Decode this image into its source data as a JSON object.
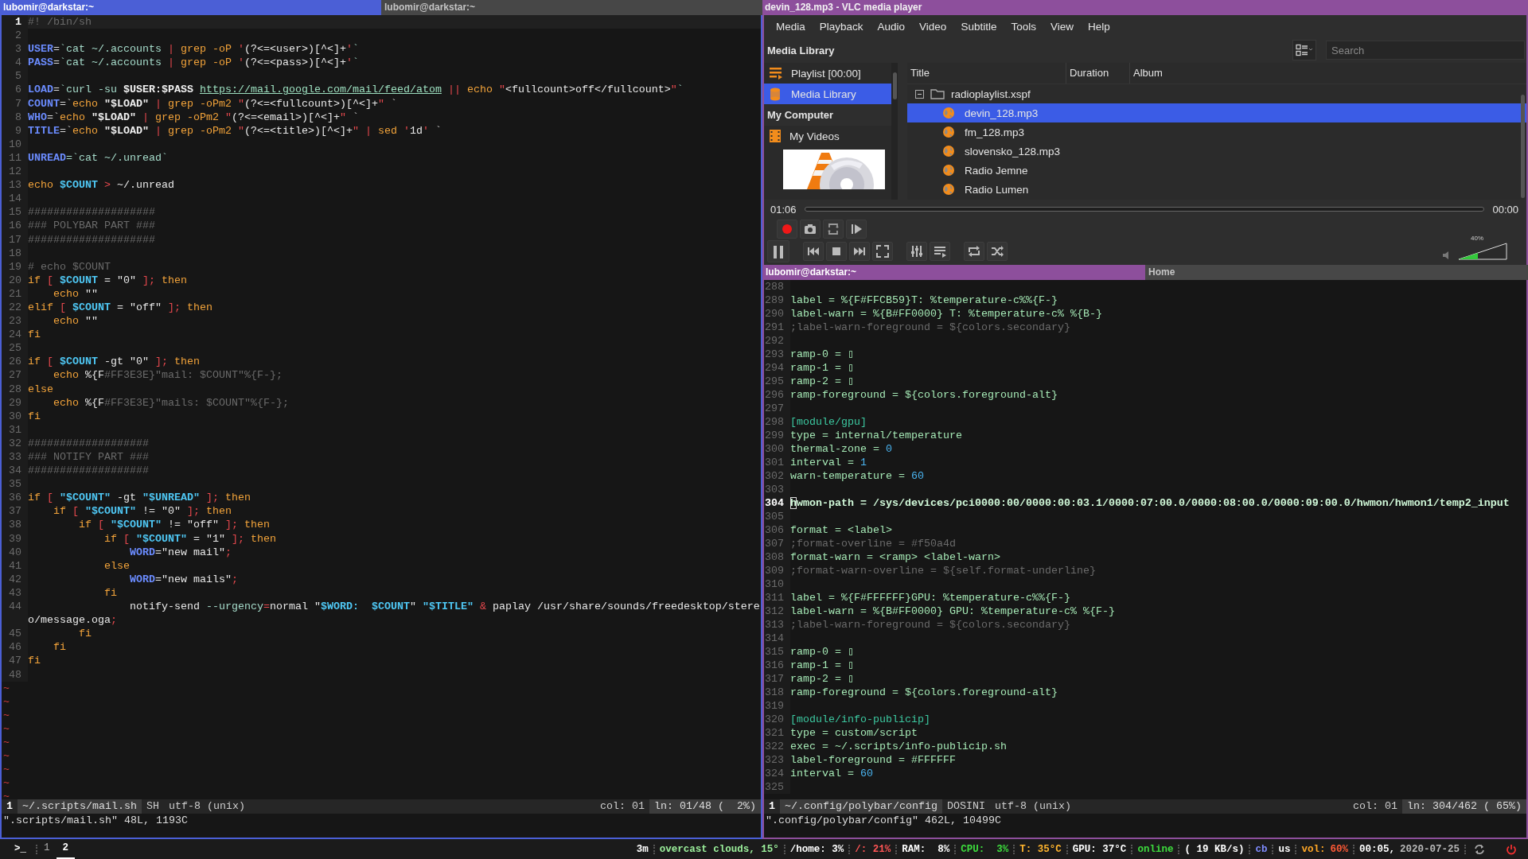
{
  "left_pane": {
    "focused": true,
    "tabs": [
      {
        "title": "lubomir@darkstar:~",
        "selected": true
      },
      {
        "title": "lubomir@darkstar:~",
        "selected": false
      }
    ],
    "editor": {
      "lines": [
        {
          "n": "1",
          "cur": true,
          "s": [
            {
              "text": "#! /bin/sh",
              "kind": "c"
            }
          ]
        },
        {
          "n": "2",
          "cur": false
        },
        {
          "n": "3",
          "cur": false,
          "s": [
            {
              "text": "USER",
              "kind": "v"
            },
            {
              "text": "=",
              "kind": "p"
            },
            {
              "text": "`cat ~/.accounts ",
              "kind": "g"
            },
            {
              "text": "|",
              "kind": "o"
            },
            {
              "text": " grep -oP ",
              "kind": "k"
            },
            {
              "text": "'",
              "kind": "o"
            },
            {
              "text": "(?<=<user>)[^<]+",
              "kind": "s"
            },
            {
              "text": "'",
              "kind": "o"
            },
            {
              "text": "`",
              "kind": "g"
            }
          ]
        },
        {
          "n": "4",
          "cur": false,
          "s": [
            {
              "text": "PASS",
              "kind": "v"
            },
            {
              "text": "=",
              "kind": "p"
            },
            {
              "text": "`cat ~/.accounts ",
              "kind": "g"
            },
            {
              "text": "|",
              "kind": "o"
            },
            {
              "text": " grep -oP ",
              "kind": "k"
            },
            {
              "text": "'",
              "kind": "o"
            },
            {
              "text": "(?<=<pass>)[^<]+",
              "kind": "s"
            },
            {
              "text": "'",
              "kind": "o"
            },
            {
              "text": "`",
              "kind": "g"
            }
          ]
        },
        {
          "n": "5",
          "cur": false
        },
        {
          "n": "6",
          "cur": false,
          "s": [
            {
              "text": "LOAD",
              "kind": "v"
            },
            {
              "text": "=",
              "kind": "p"
            },
            {
              "text": "`curl -su ",
              "kind": "g"
            },
            {
              "text": "$USER:$PASS ",
              "kind": "b"
            },
            {
              "text": "https://mail.google.com/mail/feed/atom",
              "kind": "u"
            },
            {
              "text": " ||",
              "kind": "o"
            },
            {
              "text": " echo ",
              "kind": "k"
            },
            {
              "text": "\"",
              "kind": "o"
            },
            {
              "text": "<fullcount>off</fullcount>",
              "kind": "s"
            },
            {
              "text": "\"",
              "kind": "o"
            },
            {
              "text": "`",
              "kind": "g"
            }
          ]
        },
        {
          "n": "7",
          "cur": false,
          "s": [
            {
              "text": "COUNT",
              "kind": "v"
            },
            {
              "text": "=`",
              "kind": "p"
            },
            {
              "text": "echo ",
              "kind": "k"
            },
            {
              "text": "\"$LOAD\"",
              "kind": "b"
            },
            {
              "text": " |",
              "kind": "o"
            },
            {
              "text": " grep -oPm2 ",
              "kind": "k"
            },
            {
              "text": "\"",
              "kind": "o"
            },
            {
              "text": "(?<=<fullcount>)[^<]+",
              "kind": "s"
            },
            {
              "text": "\"",
              "kind": "o"
            },
            {
              "text": " `",
              "kind": "p"
            }
          ]
        },
        {
          "n": "8",
          "cur": false,
          "s": [
            {
              "text": "WHO",
              "kind": "v"
            },
            {
              "text": "=`",
              "kind": "p"
            },
            {
              "text": "echo ",
              "kind": "k"
            },
            {
              "text": "\"$LOAD\"",
              "kind": "b"
            },
            {
              "text": " |",
              "kind": "o"
            },
            {
              "text": " grep -oPm2 ",
              "kind": "k"
            },
            {
              "text": "\"",
              "kind": "o"
            },
            {
              "text": "(?<=<email>)[^<]+",
              "kind": "s"
            },
            {
              "text": "\"",
              "kind": "o"
            },
            {
              "text": " `",
              "kind": "p"
            }
          ]
        },
        {
          "n": "9",
          "cur": false,
          "s": [
            {
              "text": "TITLE",
              "kind": "v"
            },
            {
              "text": "=`",
              "kind": "p"
            },
            {
              "text": "echo ",
              "kind": "k"
            },
            {
              "text": "\"$LOAD\"",
              "kind": "b"
            },
            {
              "text": " |",
              "kind": "o"
            },
            {
              "text": " grep -oPm2 ",
              "kind": "k"
            },
            {
              "text": "\"",
              "kind": "o"
            },
            {
              "text": "(?<=<title>)[^<]+",
              "kind": "s"
            },
            {
              "text": "\"",
              "kind": "o"
            },
            {
              "text": " |",
              "kind": "o"
            },
            {
              "text": " sed ",
              "kind": "k"
            },
            {
              "text": "'",
              "kind": "o"
            },
            {
              "text": "1d",
              "kind": "s"
            },
            {
              "text": "'",
              "kind": "o"
            },
            {
              "text": " `",
              "kind": "p"
            }
          ]
        },
        {
          "n": "10",
          "cur": false
        },
        {
          "n": "11",
          "cur": false,
          "s": [
            {
              "text": "UNREAD",
              "kind": "v"
            },
            {
              "text": "=`cat ~/.unread`",
              "kind": "g"
            }
          ]
        },
        {
          "n": "12",
          "cur": false
        },
        {
          "n": "13",
          "cur": false,
          "s": [
            {
              "text": "echo ",
              "kind": "k"
            },
            {
              "text": "$COUNT",
              "kind": "sv"
            },
            {
              "text": " >",
              "kind": "o"
            },
            {
              "text": " ~/.unread",
              "kind": "s"
            }
          ]
        },
        {
          "n": "14",
          "cur": false
        },
        {
          "n": "15",
          "cur": false,
          "s": [
            {
              "text": "####################",
              "kind": "c"
            }
          ]
        },
        {
          "n": "16",
          "cur": false,
          "s": [
            {
              "text": "### POLYBAR PART ###",
              "kind": "c"
            }
          ]
        },
        {
          "n": "17",
          "cur": false,
          "s": [
            {
              "text": "####################",
              "kind": "c"
            }
          ]
        },
        {
          "n": "18",
          "cur": false
        },
        {
          "n": "19",
          "cur": false,
          "s": [
            {
              "text": "# echo $COUNT",
              "kind": "c"
            }
          ]
        },
        {
          "n": "20",
          "cur": false,
          "s": [
            {
              "text": "if ",
              "kind": "k"
            },
            {
              "text": "[ ",
              "kind": "o"
            },
            {
              "text": "$COUNT",
              "kind": "sv"
            },
            {
              "text": " = \"0\" ",
              "kind": "s"
            },
            {
              "text": "];",
              "kind": "o"
            },
            {
              "text": " then",
              "kind": "k"
            }
          ]
        },
        {
          "n": "21",
          "cur": false,
          "s": [
            {
              "text": "    echo ",
              "kind": "k"
            },
            {
              "text": "\"\"",
              "kind": "s"
            }
          ]
        },
        {
          "n": "22",
          "cur": false,
          "s": [
            {
              "text": "elif ",
              "kind": "k"
            },
            {
              "text": "[ ",
              "kind": "o"
            },
            {
              "text": "$COUNT",
              "kind": "sv"
            },
            {
              "text": " = \"off\" ",
              "kind": "s"
            },
            {
              "text": "];",
              "kind": "o"
            },
            {
              "text": " then",
              "kind": "k"
            }
          ]
        },
        {
          "n": "23",
          "cur": false,
          "s": [
            {
              "text": "    echo ",
              "kind": "k"
            },
            {
              "text": "\"\"",
              "kind": "s"
            }
          ]
        },
        {
          "n": "24",
          "cur": false,
          "s": [
            {
              "text": "fi",
              "kind": "k"
            }
          ]
        },
        {
          "n": "25",
          "cur": false
        },
        {
          "n": "26",
          "cur": false,
          "s": [
            {
              "text": "if ",
              "kind": "k"
            },
            {
              "text": "[ ",
              "kind": "o"
            },
            {
              "text": "$COUNT",
              "kind": "sv"
            },
            {
              "text": " -gt \"0\" ",
              "kind": "s"
            },
            {
              "text": "];",
              "kind": "o"
            },
            {
              "text": " then",
              "kind": "k"
            }
          ]
        },
        {
          "n": "27",
          "cur": false,
          "s": [
            {
              "text": "    echo ",
              "kind": "k"
            },
            {
              "text": "%{F",
              "kind": "s"
            },
            {
              "text": "#FF3E3E}\"mail: $COUNT\"%{F-};",
              "kind": "c"
            }
          ]
        },
        {
          "n": "28",
          "cur": false,
          "s": [
            {
              "text": "else",
              "kind": "k"
            }
          ]
        },
        {
          "n": "29",
          "cur": false,
          "s": [
            {
              "text": "    echo ",
              "kind": "k"
            },
            {
              "text": "%{F",
              "kind": "s"
            },
            {
              "text": "#FF3E3E}\"mails: $COUNT\"%{F-};",
              "kind": "c"
            }
          ]
        },
        {
          "n": "30",
          "cur": false,
          "s": [
            {
              "text": "fi",
              "kind": "k"
            }
          ]
        },
        {
          "n": "31",
          "cur": false
        },
        {
          "n": "32",
          "cur": false,
          "s": [
            {
              "text": "###################",
              "kind": "c"
            }
          ]
        },
        {
          "n": "33",
          "cur": false,
          "s": [
            {
              "text": "### NOTIFY PART ###",
              "kind": "c"
            }
          ]
        },
        {
          "n": "34",
          "cur": false,
          "s": [
            {
              "text": "###################",
              "kind": "c"
            }
          ]
        },
        {
          "n": "35",
          "cur": false
        },
        {
          "n": "36",
          "cur": false,
          "s": [
            {
              "text": "if ",
              "kind": "k"
            },
            {
              "text": "[ ",
              "kind": "o"
            },
            {
              "text": "\"$COUNT\"",
              "kind": "sv"
            },
            {
              "text": " -gt ",
              "kind": "s"
            },
            {
              "text": "\"$UNREAD\"",
              "kind": "sv"
            },
            {
              "text": " ];",
              "kind": "o"
            },
            {
              "text": " then",
              "kind": "k"
            }
          ]
        },
        {
          "n": "37",
          "cur": false,
          "s": [
            {
              "text": "    if ",
              "kind": "k"
            },
            {
              "text": "[ ",
              "kind": "o"
            },
            {
              "text": "\"$COUNT\"",
              "kind": "sv"
            },
            {
              "text": " != \"0\" ",
              "kind": "s"
            },
            {
              "text": "];",
              "kind": "o"
            },
            {
              "text": " then",
              "kind": "k"
            }
          ]
        },
        {
          "n": "38",
          "cur": false,
          "s": [
            {
              "text": "        if ",
              "kind": "k"
            },
            {
              "text": "[ ",
              "kind": "o"
            },
            {
              "text": "\"$COUNT\"",
              "kind": "sv"
            },
            {
              "text": " != \"off\" ",
              "kind": "s"
            },
            {
              "text": "];",
              "kind": "o"
            },
            {
              "text": " then",
              "kind": "k"
            }
          ]
        },
        {
          "n": "39",
          "cur": false,
          "s": [
            {
              "text": "            if ",
              "kind": "k"
            },
            {
              "text": "[ ",
              "kind": "o"
            },
            {
              "text": "\"$COUNT\"",
              "kind": "sv"
            },
            {
              "text": " = \"1\" ",
              "kind": "s"
            },
            {
              "text": "];",
              "kind": "o"
            },
            {
              "text": " then",
              "kind": "k"
            }
          ]
        },
        {
          "n": "40",
          "cur": false,
          "s": [
            {
              "text": "                WORD",
              "kind": "v"
            },
            {
              "text": "=\"new mail\"",
              "kind": "s"
            },
            {
              "text": ";",
              "kind": "o"
            }
          ]
        },
        {
          "n": "41",
          "cur": false,
          "s": [
            {
              "text": "            else",
              "kind": "k"
            }
          ]
        },
        {
          "n": "42",
          "cur": false,
          "s": [
            {
              "text": "                WORD",
              "kind": "v"
            },
            {
              "text": "=\"new mails\"",
              "kind": "s"
            },
            {
              "text": ";",
              "kind": "o"
            }
          ]
        },
        {
          "n": "43",
          "cur": false,
          "s": [
            {
              "text": "            fi",
              "kind": "k"
            }
          ]
        },
        {
          "n": "44",
          "cur": false,
          "s": [
            {
              "text": "                notify-send ",
              "kind": "s"
            },
            {
              "text": "--urgency",
              "kind": "g"
            },
            {
              "text": "=",
              "kind": "o"
            },
            {
              "text": "normal \"",
              "kind": "s"
            },
            {
              "text": "$WORD:  $COUNT",
              "kind": "sv"
            },
            {
              "text": "\" ",
              "kind": "s"
            },
            {
              "text": "\"$TITLE\"",
              "kind": "sv"
            },
            {
              "text": " &",
              "kind": "o"
            },
            {
              "text": " paplay /usr/share/sounds/freedesktop/stereo/message.oga",
              "kind": "s"
            },
            {
              "text": ";",
              "kind": "o"
            }
          ]
        },
        {
          "n": "45",
          "cur": false,
          "s": [
            {
              "text": "        fi",
              "kind": "k"
            }
          ]
        },
        {
          "n": "46",
          "cur": false,
          "s": [
            {
              "text": "    fi",
              "kind": "k"
            }
          ]
        },
        {
          "n": "47",
          "cur": false,
          "s": [
            {
              "text": "fi",
              "kind": "k"
            }
          ]
        },
        {
          "n": "48",
          "cur": false
        }
      ],
      "tildes": [
        "~",
        "~",
        "~",
        "~",
        "~",
        "~",
        "~",
        "~",
        "~"
      ],
      "status": {
        "buffer": "1",
        "file": "~/.scripts/mail.sh",
        "filetype": "SH",
        "encoding": "utf-8 (unix)",
        "column": "col: 01",
        "position": "ln: 01/48 (  2%)"
      },
      "message": "\".scripts/mail.sh\" 48L, 1193C"
    }
  },
  "vlc": {
    "title": "devin_128.mp3 - VLC media player",
    "menu": [
      "Media",
      "Playback",
      "Audio",
      "Video",
      "Subtitle",
      "Tools",
      "View",
      "Help"
    ],
    "library_title": "Media Library",
    "search": {
      "placeholder": "Search"
    },
    "sidebar": [
      {
        "kind": "item",
        "label": "Playlist [00:00]",
        "selected": false
      },
      {
        "kind": "item",
        "label": "Media Library",
        "selected": true
      },
      {
        "kind": "header",
        "label": "My Computer"
      },
      {
        "kind": "item",
        "label": "My Videos",
        "selected": false
      }
    ],
    "art": {
      "kind": "picture"
    },
    "columns": [
      "Title",
      "Duration",
      "Album"
    ],
    "tree": [
      {
        "label": "radioplaylist.xspf",
        "expanded": true,
        "selected": false,
        "children": [
          {
            "label": "devin_128.mp3",
            "selected": true
          },
          {
            "label": "fm_128.mp3",
            "selected": false
          },
          {
            "label": "slovensko_128.mp3",
            "selected": false
          },
          {
            "label": "Radio Jemne",
            "selected": false
          },
          {
            "label": "Radio Lumen",
            "selected": false
          }
        ]
      }
    ],
    "elapsed": "01:06",
    "remaining": "00:00",
    "volume": {
      "label": "40%",
      "level": 0.4
    }
  },
  "right_terminal": {
    "focused": false,
    "tabs": [
      {
        "title": "lubomir@darkstar:~",
        "selected": true
      },
      {
        "title": "Home",
        "selected": false
      }
    ],
    "editor": {
      "lines": [
        {
          "n": "288",
          "cur": false
        },
        {
          "n": "289",
          "cur": false,
          "s": [
            {
              "text": "label = %{F#FFCB59}T: %temperature-c%%{F-}",
              "kind": "t"
            }
          ]
        },
        {
          "n": "290",
          "cur": false,
          "s": [
            {
              "text": "label-warn = %{B#FF0000} T: %temperature-c% %{B-}",
              "kind": "t"
            }
          ]
        },
        {
          "n": "291",
          "cur": false,
          "s": [
            {
              "text": ";label-warn-foreground = ${colors.secondary}",
              "kind": "c"
            }
          ]
        },
        {
          "n": "292",
          "cur": false
        },
        {
          "n": "293",
          "cur": false,
          "s": [
            {
              "text": "ramp-0 = ▯",
              "kind": "t"
            }
          ]
        },
        {
          "n": "294",
          "cur": false,
          "s": [
            {
              "text": "ramp-1 = ▯",
              "kind": "t"
            }
          ]
        },
        {
          "n": "295",
          "cur": false,
          "s": [
            {
              "text": "ramp-2 = ▯",
              "kind": "t"
            }
          ]
        },
        {
          "n": "296",
          "cur": false,
          "s": [
            {
              "text": "ramp-foreground = ${colors.foreground-alt}",
              "kind": "t"
            }
          ]
        },
        {
          "n": "297",
          "cur": false
        },
        {
          "n": "298",
          "cur": false,
          "s": [
            {
              "text": "[module/gpu]",
              "kind": "h"
            }
          ]
        },
        {
          "n": "299",
          "cur": false,
          "s": [
            {
              "text": "type = internal/temperature",
              "kind": "t"
            }
          ]
        },
        {
          "n": "300",
          "cur": false,
          "s": [
            {
              "text": "thermal-zone = ",
              "kind": "t"
            },
            {
              "text": "0",
              "kind": "n"
            }
          ]
        },
        {
          "n": "301",
          "cur": false,
          "s": [
            {
              "text": "interval = ",
              "kind": "t"
            },
            {
              "text": "1",
              "kind": "n"
            }
          ]
        },
        {
          "n": "302",
          "cur": false,
          "s": [
            {
              "text": "warn-temperature = ",
              "kind": "t"
            },
            {
              "text": "60",
              "kind": "n"
            }
          ]
        },
        {
          "n": "303",
          "cur": false
        },
        {
          "n": "304",
          "cur": true,
          "s": [
            {
              "text": "hwmon-path = /sys/devices/pci0000:00/0000:00:03.1/0000:07:00.0/0000:08:00.0/0000:09:00.0/hwmon/hwmon1/temp2_input",
              "kind": "w"
            }
          ]
        },
        {
          "n": "305",
          "cur": false
        },
        {
          "n": "306",
          "cur": false,
          "s": [
            {
              "text": "format = <label>",
              "kind": "t"
            }
          ]
        },
        {
          "n": "307",
          "cur": false,
          "s": [
            {
              "text": ";format-overline = #f50a4d",
              "kind": "c"
            }
          ]
        },
        {
          "n": "308",
          "cur": false,
          "s": [
            {
              "text": "format-warn = <ramp> <label-warn>",
              "kind": "t"
            }
          ]
        },
        {
          "n": "309",
          "cur": false,
          "s": [
            {
              "text": ";format-warn-overline = ${self.format-underline}",
              "kind": "c"
            }
          ]
        },
        {
          "n": "310",
          "cur": false
        },
        {
          "n": "311",
          "cur": false,
          "s": [
            {
              "text": "label = %{F#FFFFFF}GPU: %temperature-c%%{F-}",
              "kind": "t"
            }
          ]
        },
        {
          "n": "312",
          "cur": false,
          "s": [
            {
              "text": "label-warn = %{B#FF0000} GPU: %temperature-c% %{F-}",
              "kind": "t"
            }
          ]
        },
        {
          "n": "313",
          "cur": false,
          "s": [
            {
              "text": ";label-warn-foreground = ${colors.secondary}",
              "kind": "c"
            }
          ]
        },
        {
          "n": "314",
          "cur": false
        },
        {
          "n": "315",
          "cur": false,
          "s": [
            {
              "text": "ramp-0 = ▯",
              "kind": "t"
            }
          ]
        },
        {
          "n": "316",
          "cur": false,
          "s": [
            {
              "text": "ramp-1 = ▯",
              "kind": "t"
            }
          ]
        },
        {
          "n": "317",
          "cur": false,
          "s": [
            {
              "text": "ramp-2 = ▯",
              "kind": "t"
            }
          ]
        },
        {
          "n": "318",
          "cur": false,
          "s": [
            {
              "text": "ramp-foreground = ${colors.foreground-alt}",
              "kind": "t"
            }
          ]
        },
        {
          "n": "319",
          "cur": false
        },
        {
          "n": "320",
          "cur": false,
          "s": [
            {
              "text": "[module/info-publicip]",
              "kind": "h"
            }
          ]
        },
        {
          "n": "321",
          "cur": false,
          "s": [
            {
              "text": "type = custom/script",
              "kind": "t"
            }
          ]
        },
        {
          "n": "322",
          "cur": false,
          "s": [
            {
              "text": "exec = ~/.scripts/info-publicip.sh",
              "kind": "t"
            }
          ]
        },
        {
          "n": "323",
          "cur": false,
          "s": [
            {
              "text": "label-foreground = #FFFFFF",
              "kind": "t"
            }
          ]
        },
        {
          "n": "324",
          "cur": false,
          "s": [
            {
              "text": "interval = ",
              "kind": "t"
            },
            {
              "text": "60",
              "kind": "n"
            }
          ]
        },
        {
          "n": "325",
          "cur": false
        }
      ],
      "status": {
        "buffer": "1",
        "file": "~/.config/polybar/config",
        "filetype": "DOSINI",
        "encoding": "utf-8 (unix)",
        "column": "col: 01",
        "position": "ln: 304/462 ( 65%)"
      },
      "message": "\".config/polybar/config\" 462L, 10499C"
    }
  },
  "status_bar": {
    "prompt": ">_",
    "workspaces": [
      {
        "label": "1",
        "selected": false
      },
      {
        "label": "2",
        "selected": true
      }
    ],
    "modules": [
      {
        "parts": [
          {
            "text": "3m",
            "color": "#ffffff"
          }
        ]
      },
      {
        "parts": [
          {
            "text": "overcast clouds, 15°",
            "color": "#9cf09c"
          }
        ]
      },
      {
        "parts": [
          {
            "text": "/home: 3%",
            "color": "#ffffff"
          }
        ]
      },
      {
        "parts": [
          {
            "text": "/: 21%",
            "color": "#ff5555"
          }
        ]
      },
      {
        "parts": [
          {
            "text": "RAM:  8%",
            "color": "#ffffff"
          }
        ]
      },
      {
        "parts": [
          {
            "text": "CPU:  3%",
            "color": "#3ddc3d"
          }
        ]
      },
      {
        "parts": [
          {
            "text": "T: 35°C",
            "color": "#ffb52e"
          }
        ]
      },
      {
        "parts": [
          {
            "text": "GPU: 37°C",
            "color": "#ffffff"
          }
        ]
      },
      {
        "parts": [
          {
            "text": "online",
            "color": "#3ddc3d"
          }
        ]
      },
      {
        "parts": [
          {
            "text": "( 19 KB/s)",
            "color": "#ffffff"
          }
        ]
      },
      {
        "parts": [
          {
            "text": "cb",
            "color": "#7f8cff"
          }
        ]
      },
      {
        "parts": [
          {
            "text": "us",
            "color": "#ffffff"
          }
        ]
      },
      {
        "parts": [
          {
            "text": "vol:",
            "color": "#ffa726"
          },
          {
            "text": "60%",
            "color": "#ff5a36"
          }
        ]
      },
      {
        "parts": [
          {
            "text": "00:05,",
            "color": "#ffffff"
          },
          {
            "text": "2020-07-25",
            "color": "#b8b8b8"
          }
        ]
      }
    ]
  }
}
